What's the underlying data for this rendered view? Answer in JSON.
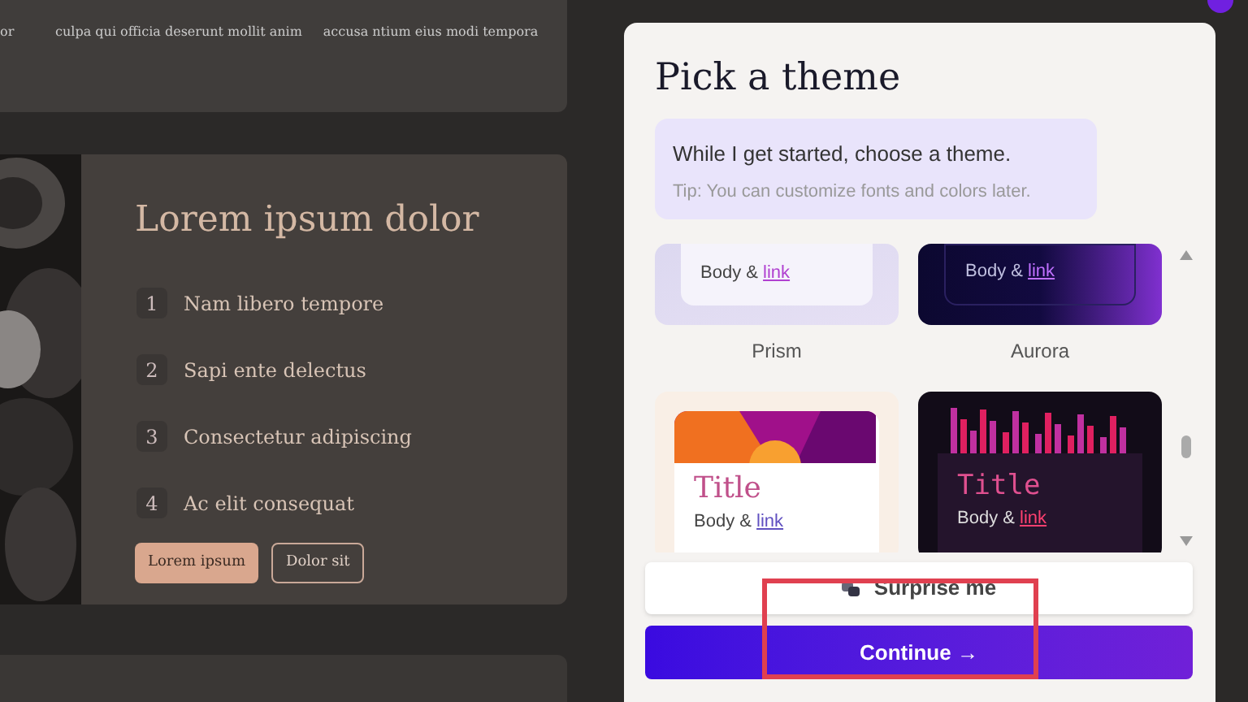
{
  "background_page": {
    "top_card": {
      "columns": [
        {
          "text": "or"
        },
        {
          "text": "culpa qui officia deserunt mollit anim"
        },
        {
          "text": "accusa ntium eius modi tempora"
        }
      ]
    },
    "feature_card": {
      "title": "Lorem ipsum dolor",
      "steps": [
        {
          "number": "1",
          "text": "Nam libero tempore"
        },
        {
          "number": "2",
          "text": "Sapi ente delectus"
        },
        {
          "number": "3",
          "text": "Consectetur adipiscing"
        },
        {
          "number": "4",
          "text": "Ac elit consequat"
        }
      ],
      "buttons": [
        {
          "label": "Lorem ipsum",
          "kind": "filled"
        },
        {
          "label": "Dolor sit",
          "kind": "outline"
        }
      ]
    }
  },
  "theme_panel": {
    "title": "Pick a theme",
    "message": "While I get started, choose a theme.",
    "tip": "Tip: You can customize fonts and colors later.",
    "themes": [
      {
        "kind": "prism",
        "name": "Prism",
        "body": "Body &",
        "link": "link"
      },
      {
        "kind": "aurora",
        "name": "Aurora",
        "body": "Body &",
        "link": "link"
      },
      {
        "kind": "sunset",
        "title": "Title",
        "body": "Body &",
        "link": "link"
      },
      {
        "kind": "neon",
        "title": "Title",
        "body": "Body &",
        "link": "link"
      }
    ],
    "surprise_button": "Surprise me",
    "continue_button": "Continue →"
  }
}
